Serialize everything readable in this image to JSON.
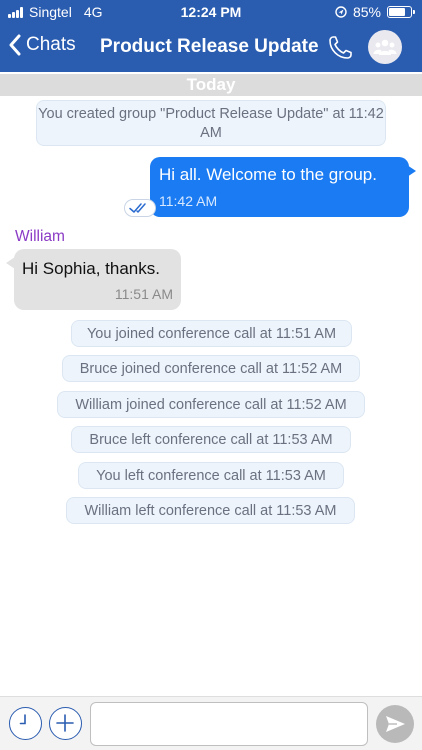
{
  "status_bar": {
    "carrier": "Singtel",
    "network": "4G",
    "time": "12:24 PM",
    "battery_percent": "85%",
    "battery_level": 0.85
  },
  "nav": {
    "back_label": "Chats",
    "title": "Product Release Update"
  },
  "date_divider": "Today",
  "messages": {
    "created_notice": "You created group \"Product Release Update\" at 11:42 AM",
    "outgoing": {
      "text": "Hi all. Welcome to the group.",
      "time": "11:42 AM"
    },
    "incoming": {
      "sender": "William",
      "text": "Hi Sophia, thanks.",
      "time": "11:51 AM"
    },
    "events": [
      "You joined conference call at 11:51 AM",
      "Bruce joined conference call at 11:52 AM",
      "William joined conference call at 11:52 AM",
      "Bruce left conference call at 11:53 AM",
      "You left conference call at 11:53 AM",
      "William left conference call at 11:53 AM"
    ]
  },
  "composer": {
    "input_value": "",
    "placeholder": ""
  },
  "colors": {
    "header": "#2a5cb0",
    "outgoing_bubble": "#1a7bf2",
    "incoming_bubble": "#e2e2e2",
    "sender_name": "#8b3bc6",
    "system_bg": "#eef4fb"
  },
  "icons": [
    "signal-icon",
    "location-icon",
    "battery-icon",
    "back-chevron-icon",
    "phone-icon",
    "group-icon",
    "read-ticks-icon",
    "clock-icon",
    "plus-icon",
    "send-icon"
  ]
}
